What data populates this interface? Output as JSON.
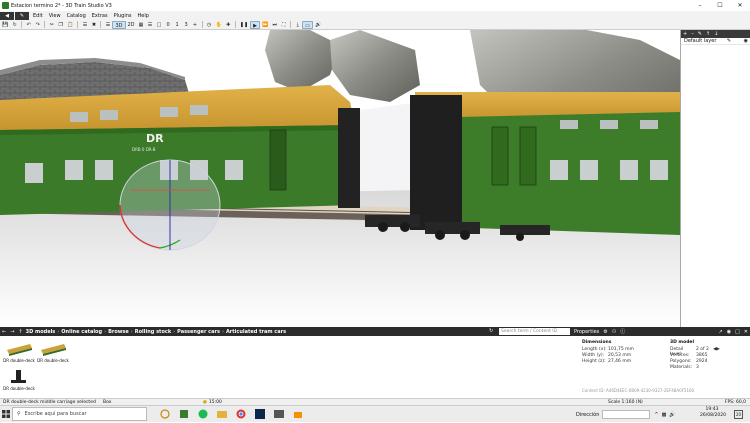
{
  "window": {
    "title": "Estacion termino 2* - 3D Train Studio V3",
    "controls": [
      "–",
      "☐",
      "✕"
    ]
  },
  "menu": {
    "items": [
      "Edit",
      "View",
      "Catalog",
      "Extras",
      "Plugins",
      "Help"
    ]
  },
  "toolbar": {
    "view_3d": "3D",
    "view_2d": "2D",
    "counter_a": "0",
    "counter_b": "1",
    "counter_c": "3"
  },
  "layers": {
    "add": "+",
    "remove": "–",
    "items": [
      {
        "label": "Default layer"
      }
    ]
  },
  "catalog": {
    "breadcrumbs": [
      "3D models",
      "Online catalog",
      "Browse",
      "Rolling stock",
      "Passenger cars",
      "Articulated tram cars"
    ],
    "search_placeholder": "Search term / Content ID",
    "items": [
      {
        "label": "DR double-deck"
      },
      {
        "label": "DR double-deck"
      },
      {
        "label": "DR double-deck"
      }
    ],
    "status_selected": "DR double-deck middle carriage selected",
    "status_box": "Box",
    "status_time": "15:00"
  },
  "properties": {
    "tab_label": "Properties",
    "dimensions_title": "Dimensions",
    "length_label": "Length (x):",
    "length_value": "101,75 mm",
    "width_label": "Width (y):",
    "width_value": "20,53 mm",
    "height_label": "Height (z):",
    "height_value": "27,46 mm",
    "model_title": "3D model",
    "detail_label": "Detail level:",
    "detail_value": "2 of 2",
    "vertices_label": "Vertices:",
    "vertices_value": "3865",
    "polygons_label": "Polygons:",
    "polygons_value": "2924",
    "materials_label": "Materials:",
    "materials_value": "3",
    "content_id": "Content ID: A46D4EEC-0B09-4230-9327-2EF48A0F5160",
    "scale": "Scale 1:160 (N)",
    "fps": "FPS: 60,0"
  },
  "car_logo": {
    "brand": "DR",
    "sub": "DRB 0 DR-B"
  },
  "taskbar": {
    "search_placeholder": "Escribe aquí para buscar",
    "direction_label": "Dirección",
    "time": "19:43",
    "date": "26/08/2020",
    "notif": "20"
  }
}
